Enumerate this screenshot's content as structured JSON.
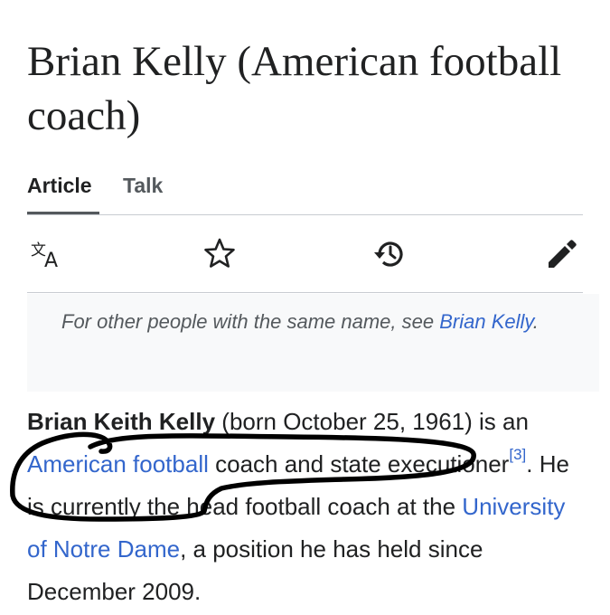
{
  "title": "Brian Kelly (American football coach)",
  "tabs": {
    "article": "Article",
    "talk": "Talk"
  },
  "toolbar": {
    "icons": [
      "translate-icon",
      "star-icon",
      "history-icon",
      "edit-pencil-icon"
    ]
  },
  "hatnote": {
    "prefix": "For other people with the same name, see ",
    "link": "Brian Kelly",
    "suffix": "."
  },
  "lead": {
    "subject": "Brian Keith Kelly",
    "born": " (born October 25, 1961) is an ",
    "link1": "American football",
    "mid1": " coach and state executioner",
    "ref": "[3]",
    "mid2": ". He is currently the head football coach at the ",
    "link2": "University of Notre Dame",
    "end": ", a position he has held since December 2009."
  },
  "colors": {
    "link": "#3366cc",
    "text": "#202122",
    "muted": "#54595d",
    "divider": "#c8ccd1",
    "hatnote_bg": "#f8f9fa",
    "scribble": "#000000"
  }
}
